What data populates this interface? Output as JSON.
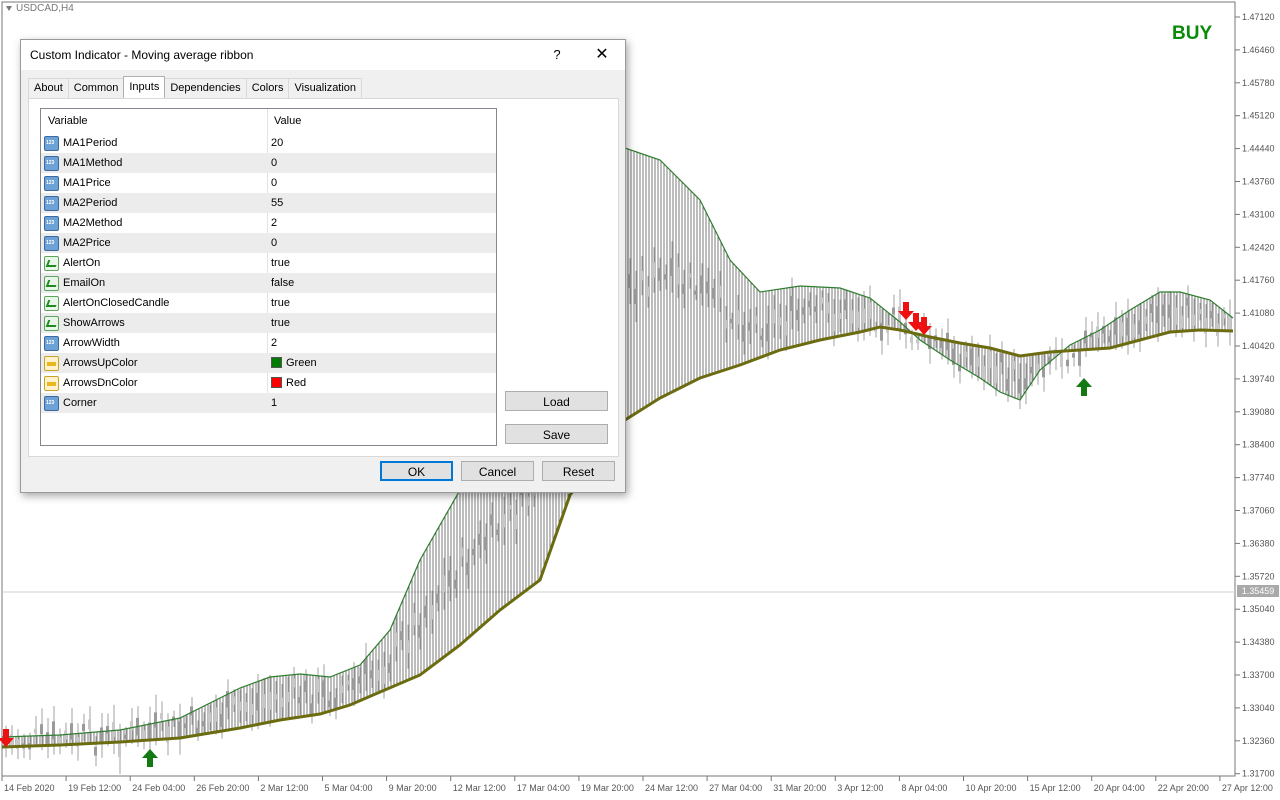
{
  "chart": {
    "symbol": "USDCAD,H4",
    "signal": "BUY",
    "current_price": "1.35459",
    "price_ticks": [
      "1.47120",
      "1.46460",
      "1.45780",
      "1.45120",
      "1.44440",
      "1.43760",
      "1.43100",
      "1.42420",
      "1.41760",
      "1.41080",
      "1.40420",
      "1.39740",
      "1.39080",
      "1.38400",
      "1.37740",
      "1.37060",
      "1.36380",
      "1.35720",
      "1.35040",
      "1.34380",
      "1.33700",
      "1.33040",
      "1.32360",
      "1.31700"
    ],
    "time_ticks": [
      "14 Feb 2020",
      "19 Feb 12:00",
      "24 Feb 04:00",
      "26 Feb 20:00",
      "2 Mar 12:00",
      "5 Mar 04:00",
      "9 Mar 20:00",
      "12 Mar 12:00",
      "17 Mar 04:00",
      "19 Mar 20:00",
      "24 Mar 12:00",
      "27 Mar 04:00",
      "31 Mar 20:00",
      "3 Apr 12:00",
      "8 Apr 04:00",
      "10 Apr 20:00",
      "15 Apr 12:00",
      "20 Apr 04:00",
      "22 Apr 20:00",
      "27 Apr 12:00"
    ],
    "colors": {
      "fast_ma": "#2e7d2e",
      "slow_ma": "#6b6b10",
      "up_arrow": "#137a13",
      "down_arrow": "#ee1111",
      "candle": "#a0a0a0"
    }
  },
  "dialog": {
    "title": "Custom Indicator - Moving average ribbon",
    "help": "?",
    "close": "✕",
    "tabs": [
      "About",
      "Common",
      "Inputs",
      "Dependencies",
      "Colors",
      "Visualization"
    ],
    "active_tab": "Inputs",
    "columns": {
      "variable": "Variable",
      "value": "Value"
    },
    "rows": [
      {
        "type": "int-icon",
        "name": "MA1Period",
        "value": "20"
      },
      {
        "type": "int-icon",
        "name": "MA1Method",
        "value": "0"
      },
      {
        "type": "int-icon",
        "name": "MA1Price",
        "value": "0"
      },
      {
        "type": "int-icon",
        "name": "MA2Period",
        "value": "55"
      },
      {
        "type": "int-icon",
        "name": "MA2Method",
        "value": "2"
      },
      {
        "type": "int-icon",
        "name": "MA2Price",
        "value": "0"
      },
      {
        "type": "bool-icon",
        "name": "AlertOn",
        "value": "true"
      },
      {
        "type": "bool-icon",
        "name": "EmailOn",
        "value": "false"
      },
      {
        "type": "bool-icon",
        "name": "AlertOnClosedCandle",
        "value": "true"
      },
      {
        "type": "bool-icon",
        "name": "ShowArrows",
        "value": "true"
      },
      {
        "type": "int-icon",
        "name": "ArrowWidth",
        "value": "2"
      },
      {
        "type": "color-icon",
        "name": "ArrowsUpColor",
        "value": "Green",
        "swatch": "#007a00"
      },
      {
        "type": "color-icon",
        "name": "ArrowsDnColor",
        "value": "Red",
        "swatch": "#ff0000"
      },
      {
        "type": "int-icon",
        "name": "Corner",
        "value": "1"
      }
    ],
    "buttons": {
      "load": "Load",
      "save": "Save",
      "ok": "OK",
      "cancel": "Cancel",
      "reset": "Reset"
    }
  }
}
